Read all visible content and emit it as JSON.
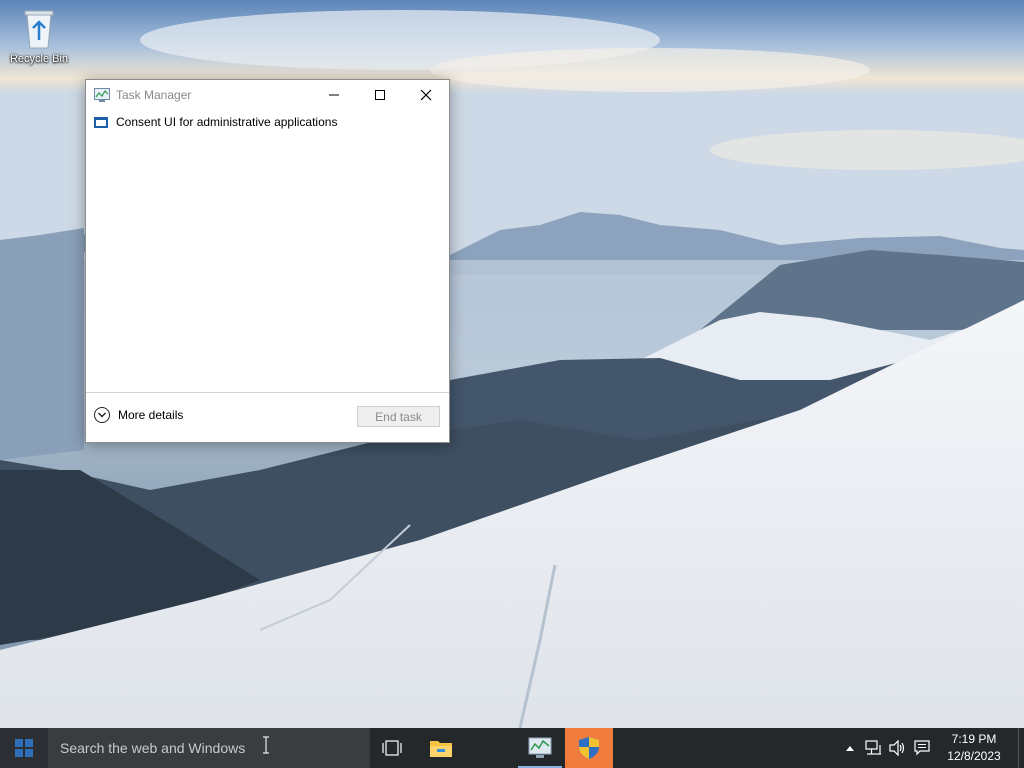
{
  "desktop": {
    "icons": [
      {
        "label": "Recycle Bin",
        "icon": "recycle-bin-icon"
      }
    ]
  },
  "task_manager": {
    "title": "Task Manager",
    "items": [
      {
        "label": "Consent UI for administrative applications",
        "icon": "window-icon"
      }
    ],
    "more_details_label": "More details",
    "end_task_label": "End task"
  },
  "taskbar": {
    "search_placeholder": "Search the web and Windows",
    "pinned": [
      "task-view-icon",
      "file-explorer-icon",
      "task-manager-icon",
      "uac-shield-icon"
    ],
    "clock": {
      "time": "7:19 PM",
      "date": "12/8/2023"
    }
  },
  "colors": {
    "taskbar_bg": "#25282b",
    "search_bg": "#3a3d40",
    "uac_highlight": "#f07c3e",
    "accent": "#1c5ea8"
  }
}
